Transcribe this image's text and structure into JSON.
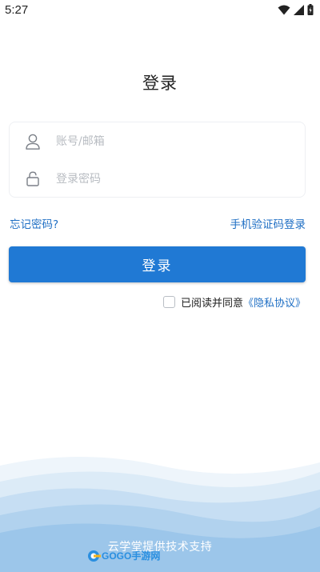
{
  "status_bar": {
    "time": "5:27"
  },
  "page": {
    "title": "登录"
  },
  "form": {
    "account_placeholder": "账号/邮箱",
    "password_placeholder": "登录密码"
  },
  "links": {
    "forgot_password": "忘记密码?",
    "sms_login": "手机验证码登录"
  },
  "login_button": "登录",
  "agreement": {
    "prefix": "已阅读并同意",
    "link": "《隐私协议》",
    "checked": false
  },
  "footer": {
    "powered_by": "云学堂提供技术支持"
  },
  "watermark": {
    "text": "GOGO手游网"
  },
  "colors": {
    "accent": "#2079d4",
    "link": "#1f6fc4",
    "wave_light": "#dcebf7",
    "wave_dark": "#9cc6ea"
  }
}
